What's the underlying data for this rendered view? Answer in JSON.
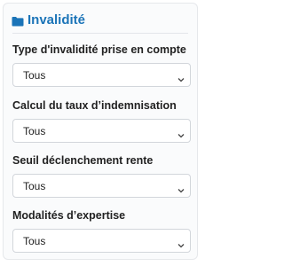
{
  "section": {
    "title": "Invalidité",
    "icon": "folder-icon",
    "accent_color": "#1b74b8"
  },
  "filters": [
    {
      "label": "Type d'invalidité prise en compte",
      "value": "Tous"
    },
    {
      "label": "Calcul du taux d’indemnisation",
      "value": "Tous"
    },
    {
      "label": "Seuil déclenchement rente",
      "value": "Tous"
    },
    {
      "label": "Modalités d’expertise",
      "value": "Tous"
    }
  ]
}
